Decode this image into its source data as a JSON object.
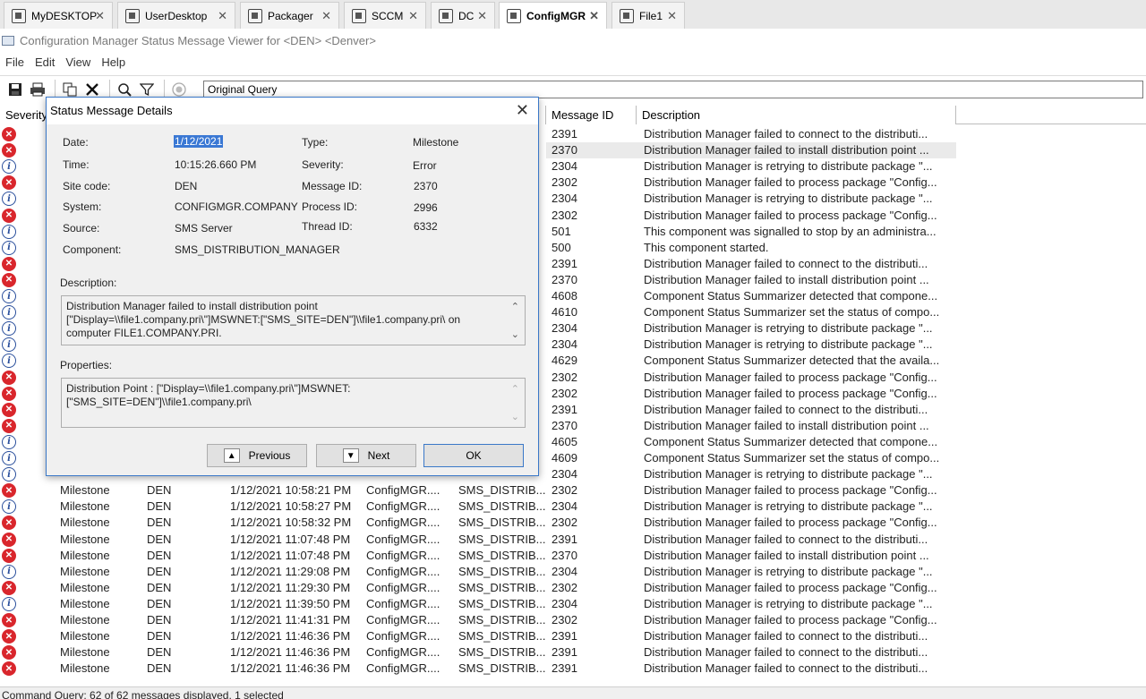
{
  "tabs": [
    {
      "label": "MyDESKTOP",
      "active": false
    },
    {
      "label": "UserDesktop",
      "active": false
    },
    {
      "label": "Packager",
      "active": false
    },
    {
      "label": "SCCM",
      "active": false
    },
    {
      "label": "DC",
      "active": false
    },
    {
      "label": "ConfigMGR",
      "active": true
    },
    {
      "label": "File1",
      "active": false
    }
  ],
  "window_title": "Configuration Manager Status Message Viewer for <DEN> <Denver>",
  "menu": [
    "File",
    "Edit",
    "View",
    "Help"
  ],
  "toolbar": {
    "icons": [
      "save-icon",
      "print-icon",
      "copy-icon",
      "delete-icon",
      "refresh-icon",
      "filter-icon",
      "stop-icon"
    ],
    "query": "Original Query"
  },
  "columns": {
    "severity": "Severity",
    "message_id": "Message ID",
    "description": "Description"
  },
  "rows_top": [
    {
      "sev": "error",
      "id": "2391",
      "desc": "Distribution Manager failed to connect to the distributi..."
    },
    {
      "sev": "error",
      "id": "2370",
      "desc": "Distribution Manager failed to install distribution point ...",
      "selected": true
    },
    {
      "sev": "info",
      "id": "2304",
      "desc": "Distribution Manager is retrying to distribute package \"..."
    },
    {
      "sev": "error",
      "id": "2302",
      "desc": "Distribution Manager failed to process package \"Config..."
    },
    {
      "sev": "info",
      "id": "2304",
      "desc": "Distribution Manager is retrying to distribute package \"..."
    },
    {
      "sev": "error",
      "id": "2302",
      "desc": "Distribution Manager failed to process package \"Config..."
    },
    {
      "sev": "info",
      "id": "501",
      "desc": "This component was signalled to stop by an administra..."
    },
    {
      "sev": "info",
      "id": "500",
      "desc": "This component started."
    },
    {
      "sev": "error",
      "id": "2391",
      "desc": "Distribution Manager failed to connect to the distributi..."
    },
    {
      "sev": "error",
      "id": "2370",
      "desc": "Distribution Manager failed to install distribution point ..."
    },
    {
      "sev": "info",
      "id": "4608",
      "desc": "Component Status Summarizer detected that compone..."
    },
    {
      "sev": "info",
      "id": "4610",
      "desc": "Component Status Summarizer set the status of compo..."
    },
    {
      "sev": "info",
      "id": "2304",
      "desc": "Distribution Manager is retrying to distribute package \"..."
    },
    {
      "sev": "info",
      "id": "2304",
      "desc": "Distribution Manager is retrying to distribute package \"..."
    },
    {
      "sev": "info",
      "id": "4629",
      "desc": "Component Status Summarizer detected that the availa..."
    },
    {
      "sev": "error",
      "id": "2302",
      "desc": "Distribution Manager failed to process package \"Config..."
    },
    {
      "sev": "error",
      "id": "2302",
      "desc": "Distribution Manager failed to process package \"Config..."
    },
    {
      "sev": "error",
      "id": "2391",
      "desc": "Distribution Manager failed to connect to the distributi..."
    },
    {
      "sev": "error",
      "id": "2370",
      "desc": "Distribution Manager failed to install distribution point ..."
    },
    {
      "sev": "info",
      "id": "4605",
      "desc": "Component Status Summarizer detected that compone..."
    },
    {
      "sev": "info",
      "id": "4609",
      "desc": "Component Status Summarizer set the status of compo..."
    },
    {
      "sev": "info",
      "id": "2304",
      "desc": "Distribution Manager is retrying to distribute package \"..."
    }
  ],
  "rows_full": [
    {
      "sev": "error",
      "type": "Milestone",
      "site": "DEN",
      "date": "1/12/2021 10:58:21 PM",
      "system": "ConfigMGR....",
      "component": "SMS_DISTRIB...",
      "id": "2302",
      "desc": "Distribution Manager failed to process package \"Config..."
    },
    {
      "sev": "info",
      "type": "Milestone",
      "site": "DEN",
      "date": "1/12/2021 10:58:27 PM",
      "system": "ConfigMGR....",
      "component": "SMS_DISTRIB...",
      "id": "2304",
      "desc": "Distribution Manager is retrying to distribute package \"..."
    },
    {
      "sev": "error",
      "type": "Milestone",
      "site": "DEN",
      "date": "1/12/2021 10:58:32 PM",
      "system": "ConfigMGR....",
      "component": "SMS_DISTRIB...",
      "id": "2302",
      "desc": "Distribution Manager failed to process package \"Config..."
    },
    {
      "sev": "error",
      "type": "Milestone",
      "site": "DEN",
      "date": "1/12/2021 11:07:48 PM",
      "system": "ConfigMGR....",
      "component": "SMS_DISTRIB...",
      "id": "2391",
      "desc": "Distribution Manager failed to connect to the distributi..."
    },
    {
      "sev": "error",
      "type": "Milestone",
      "site": "DEN",
      "date": "1/12/2021 11:07:48 PM",
      "system": "ConfigMGR....",
      "component": "SMS_DISTRIB...",
      "id": "2370",
      "desc": "Distribution Manager failed to install distribution point ..."
    },
    {
      "sev": "info",
      "type": "Milestone",
      "site": "DEN",
      "date": "1/12/2021 11:29:08 PM",
      "system": "ConfigMGR....",
      "component": "SMS_DISTRIB...",
      "id": "2304",
      "desc": "Distribution Manager is retrying to distribute package \"..."
    },
    {
      "sev": "error",
      "type": "Milestone",
      "site": "DEN",
      "date": "1/12/2021 11:29:30 PM",
      "system": "ConfigMGR....",
      "component": "SMS_DISTRIB...",
      "id": "2302",
      "desc": "Distribution Manager failed to process package \"Config..."
    },
    {
      "sev": "info",
      "type": "Milestone",
      "site": "DEN",
      "date": "1/12/2021 11:39:50 PM",
      "system": "ConfigMGR....",
      "component": "SMS_DISTRIB...",
      "id": "2304",
      "desc": "Distribution Manager is retrying to distribute package \"..."
    },
    {
      "sev": "error",
      "type": "Milestone",
      "site": "DEN",
      "date": "1/12/2021 11:41:31 PM",
      "system": "ConfigMGR....",
      "component": "SMS_DISTRIB...",
      "id": "2302",
      "desc": "Distribution Manager failed to process package \"Config..."
    },
    {
      "sev": "error",
      "type": "Milestone",
      "site": "DEN",
      "date": "1/12/2021 11:46:36 PM",
      "system": "ConfigMGR....",
      "component": "SMS_DISTRIB...",
      "id": "2391",
      "desc": "Distribution Manager failed to connect to the distributi..."
    },
    {
      "sev": "error",
      "type": "Milestone",
      "site": "DEN",
      "date": "1/12/2021 11:46:36 PM",
      "system": "ConfigMGR....",
      "component": "SMS_DISTRIB...",
      "id": "2391",
      "desc": "Distribution Manager failed to connect to the distributi..."
    },
    {
      "sev": "error",
      "type": "Milestone",
      "site": "DEN",
      "date": "1/12/2021 11:46:36 PM",
      "system": "ConfigMGR....",
      "component": "SMS_DISTRIB...",
      "id": "2391",
      "desc": "Distribution Manager failed to connect to the distributi..."
    }
  ],
  "statusbar": "Command Query: 62 of 62 messages displayed, 1 selected",
  "dialog": {
    "title": "Status Message Details",
    "fields": {
      "date_label": "Date:",
      "date": "1/12/2021",
      "time_label": "Time:",
      "time": "10:15:26.660 PM",
      "site_label": "Site code:",
      "site": "DEN",
      "system_label": "System:",
      "system": "CONFIGMGR.COMPANY",
      "source_label": "Source:",
      "source": "SMS Server",
      "component_label": "Component:",
      "component": "SMS_DISTRIBUTION_MANAGER",
      "type_label": "Type:",
      "type": "Milestone",
      "severity_label": "Severity:",
      "severity": "Error",
      "msgid_label": "Message ID:",
      "msgid": "2370",
      "procid_label": "Process ID:",
      "procid": "2996",
      "threadid_label": "Thread ID:",
      "threadid": "6332"
    },
    "description_label": "Description:",
    "description": "Distribution Manager failed to install distribution point [\"Display=\\\\file1.company.pri\\\"]MSWNET:[\"SMS_SITE=DEN\"]\\\\file1.company.pri\\ on computer FILE1.COMPANY.PRI.",
    "properties_label": "Properties:",
    "properties": "Distribution Point : [\"Display=\\\\file1.company.pri\\\"]MSWNET:[\"SMS_SITE=DEN\"]\\\\file1.company.pri\\",
    "buttons": {
      "previous": "Previous",
      "next": "Next",
      "ok": "OK"
    }
  }
}
